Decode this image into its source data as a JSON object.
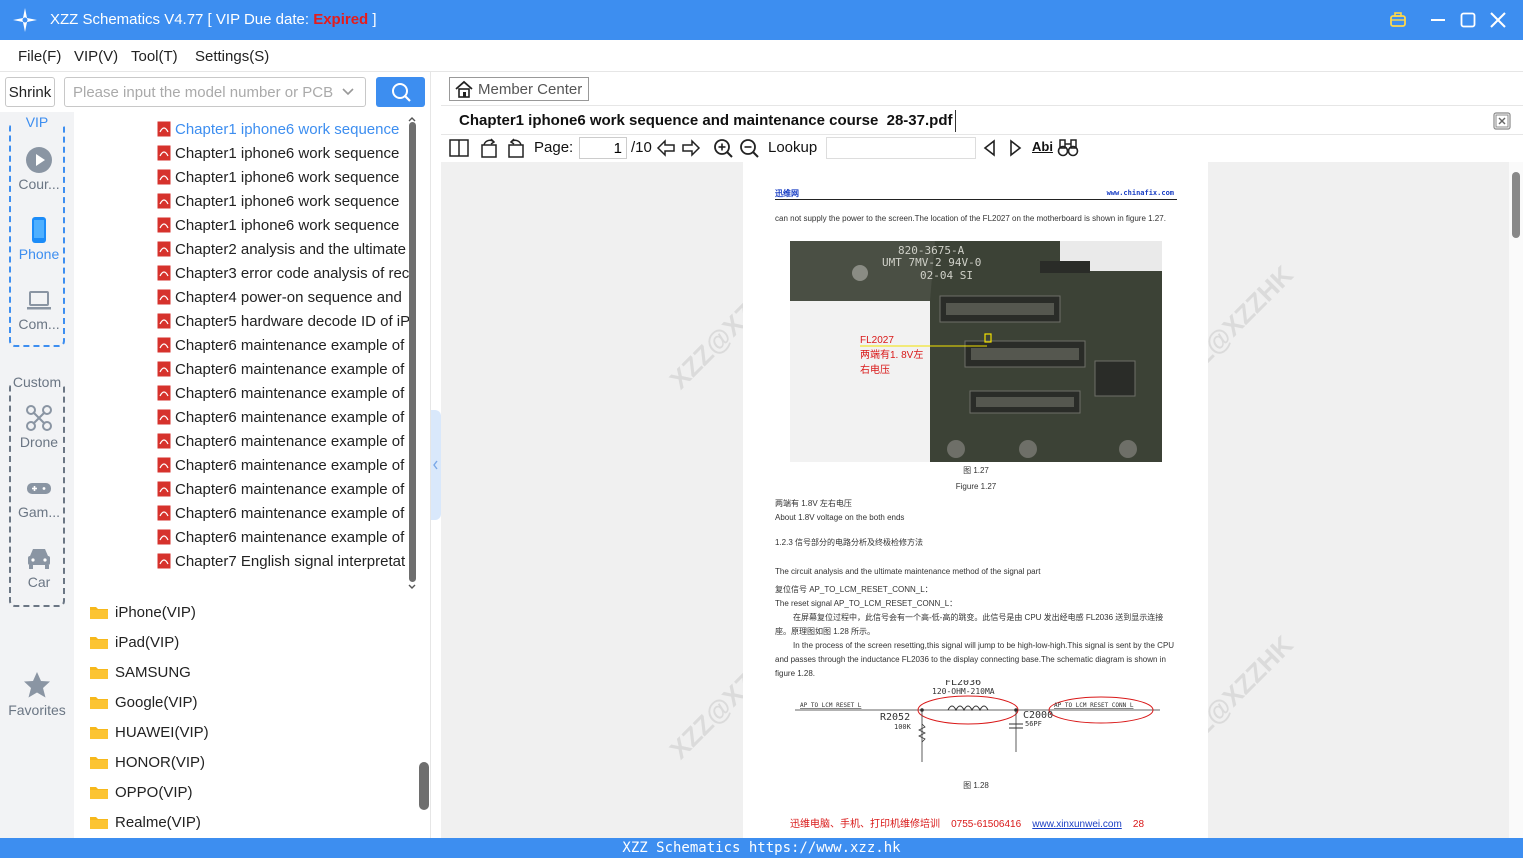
{
  "titlebar": {
    "title_prefix": "XZZ Schematics V4.77 [ VIP Due date: ",
    "title_status": "Expired",
    "title_suffix": " ]"
  },
  "menu": [
    "File(F)",
    "VIP(V)",
    "Tool(T)",
    "Settings(S)"
  ],
  "search": {
    "shrink_label": "Shrink",
    "placeholder": "Please input the model number or PCB"
  },
  "nav": {
    "vip_label": "VIP",
    "custom_label": "Custom",
    "vip_items": [
      "Cour...",
      "Phone",
      "Com..."
    ],
    "custom_items": [
      "Drone",
      "Gam...",
      "Car"
    ],
    "favorites": "Favorites"
  },
  "tree": {
    "files": [
      "Chapter1 iphone6 work sequence",
      "Chapter1 iphone6 work sequence",
      "Chapter1 iphone6 work sequence",
      "Chapter1 iphone6 work sequence",
      "Chapter1 iphone6 work sequence",
      "Chapter2 analysis and the ultimate",
      "Chapter3 error code analysis of rec",
      "Chapter4 power-on sequence and",
      "Chapter5 hardware decode ID of iP",
      "Chapter6 maintenance example of",
      "Chapter6 maintenance example of",
      "Chapter6 maintenance example of",
      "Chapter6 maintenance example of",
      "Chapter6 maintenance example of",
      "Chapter6 maintenance example of",
      "Chapter6 maintenance example of",
      "Chapter6 maintenance example of",
      "Chapter6 maintenance example of",
      "Chapter7 English signal interpretat"
    ],
    "selected_index": 0,
    "folders": [
      "iPhone(VIP)",
      "iPad(VIP)",
      "SAMSUNG",
      "Google(VIP)",
      "HUAWEI(VIP)",
      "HONOR(VIP)",
      "OPPO(VIP)",
      "Realme(VIP)"
    ]
  },
  "viewer": {
    "member_center": "Member Center",
    "doc_title": "Chapter1 iphone6 work sequence and maintenance course  28-37.pdf",
    "page_label": "Page:",
    "page_value": "1",
    "page_total": "/10",
    "lookup_label": "Lookup",
    "abi_label": "Abi"
  },
  "pdf_page": {
    "header_left": "迅维网",
    "header_right": "www.chinafix.com",
    "intro": "can not supply the power to the screen.The location of the FL2027 on the motherboard is shown in figure 1.27.",
    "board_text1": "820-3675-A",
    "board_text2": "UMT 7MV-2 94V-0",
    "board_text3": "02-04 SI",
    "fl_label_line1": "FL2027",
    "fl_label_line2": "两端有1. 8V左",
    "fl_label_line3": "右电压",
    "fig_cn": "图 1.27",
    "fig_en": "Figure 1.27",
    "note_cn": "两端有 1.8V 左右电压",
    "note_en": "About 1.8V voltage on the both ends",
    "section": "1.2.3  信号部分的电路分析及终极检修方法",
    "section_en": "The circuit analysis and the ultimate maintenance method of the signal part",
    "reset_cn": "复位信号 AP_TO_LCM_RESET_CONN_L：",
    "reset_en": "The reset signal AP_TO_LCM_RESET_CONN_L：",
    "para_cn": "在屏幕复位过程中，此信号会有一个高-低-高的跳变。此信号是由 CPU 发出经电感 FL2036 送到显示连接座。原理图如图 1.28 所示。",
    "para_en": "In the process of the screen resetting,this signal will jump to be high-low-high.This signal is sent by the CPU and passes through the inductance FL2036 to the display connecting base.The schematic diagram is shown in figure 1.28.",
    "sch_fl": "FL2036",
    "sch_fl_val": "120-OHM-210MA",
    "sch_left_net": "AP_TO_LCM_RESET_L",
    "sch_right_net": "AP_TO_LCM_RESET_CONN_L",
    "sch_r": "R2052",
    "sch_r_val": "100K",
    "sch_c": "C2000",
    "sch_c_val": "56PF",
    "fig2_cn": "图 1.28",
    "footer_text": "迅维电脑、手机、打印机维修培训    0755-61506416    ",
    "footer_link": "www.xinxunwei.com",
    "footer_page": "    28",
    "watermark": "XZZ@XZZHK"
  },
  "statusbar": "XZZ Schematics https://www.xzz.hk",
  "colors": {
    "accent": "#3d8ef0",
    "expired": "#e51c1c",
    "pdf_red": "#d91818",
    "nav_gray": "#6b7684"
  }
}
